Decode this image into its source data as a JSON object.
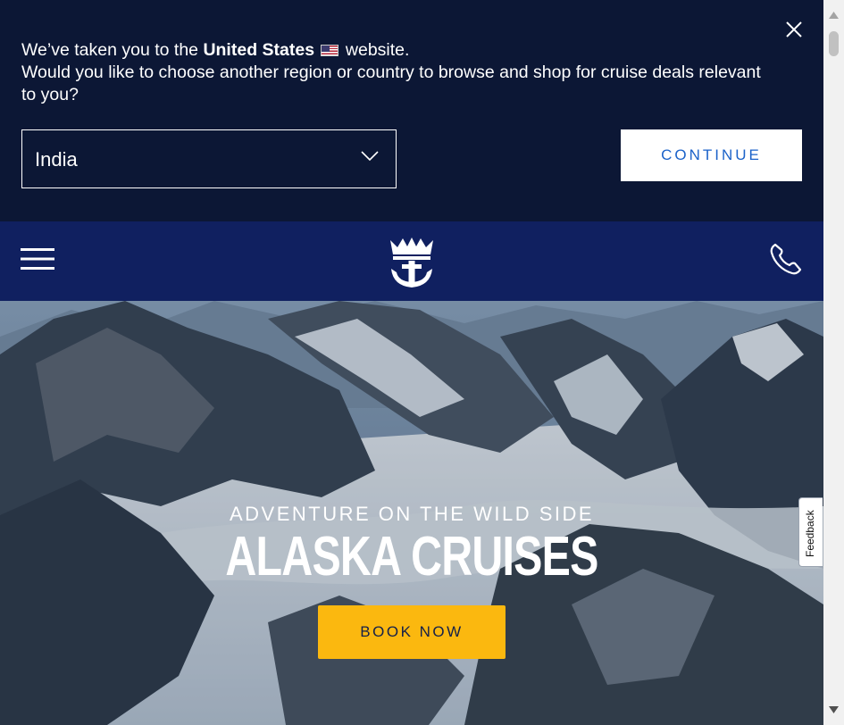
{
  "region_banner": {
    "message_pre": "We’ve taken you to the ",
    "message_country": "United States",
    "message_post": " website.",
    "message_line2": "Would you like to choose another region or country to browse and shop for cruise deals relevant to you?",
    "flag_icon": "us-flag-icon",
    "close_icon": "close-icon",
    "select_value": "India",
    "continue_label": "CONTINUE"
  },
  "navbar": {
    "menu_icon": "hamburger-menu-icon",
    "logo_icon": "crown-anchor-logo-icon",
    "phone_icon": "phone-icon"
  },
  "hero": {
    "eyebrow": "ADVENTURE ON THE WILD SIDE",
    "title": "ALASKA CRUISES",
    "cta_label": "BOOK NOW"
  },
  "feedback": {
    "label": "Feedback"
  },
  "colors": {
    "banner_bg": "#0c1735",
    "nav_bg": "#102060",
    "continue_text": "#1b62c9",
    "book_now_bg": "#fbb80f"
  }
}
